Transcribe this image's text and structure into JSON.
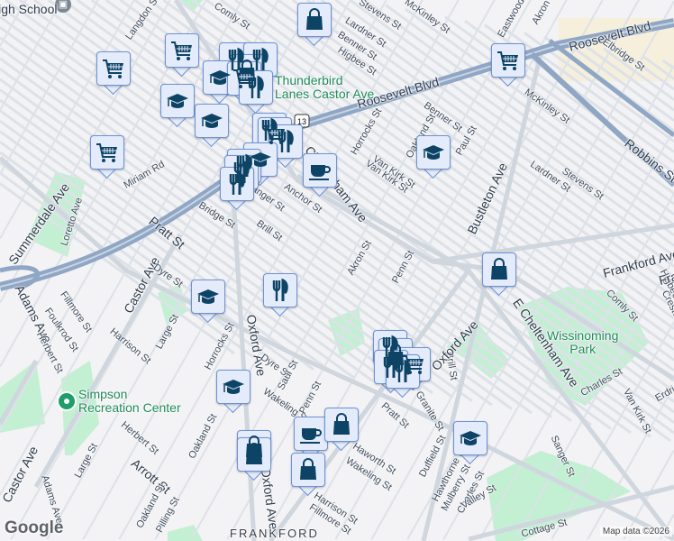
{
  "map": {
    "colors": {
      "background": "#f3f2f4",
      "park": "#c3efd3",
      "highway": "#8fa6c4",
      "road": "#d7dde4",
      "marker_fill": "#e4ebfb",
      "marker_border": "#6d93d6",
      "icon": "#0d4466",
      "poi_text": "#1e8a5a"
    },
    "labels": [
      "High School",
      "Roosevelt Blvd",
      "Roosevelt Blvd",
      "Comly St",
      "Stevens St",
      "Lardner St",
      "Benner St",
      "Higbee St",
      "McKinley St",
      "Eastwood St",
      "Akron St",
      "Elbridge St",
      "McKinley St",
      "Benner St",
      "Horrocks St",
      "Oakland St",
      "Paul St",
      "Van Kirk St",
      "Robbins St",
      "Bustleton Ave",
      "Lardner St",
      "Stevens St",
      "Langdon St",
      "Summerdale Ave",
      "Loretto Ave",
      "Miriam Rd",
      "Pratt St",
      "Bridge St",
      "Brill St",
      "Anchor St",
      "Sanger St",
      "Cheltenham Ave",
      "Akron St",
      "Penn St",
      "Frankford Ave",
      "Castor Ave",
      "Dyre St",
      "Fillmore St",
      "Foulkrod St",
      "Adams Ave",
      "Herbert St",
      "Harrison St",
      "Large St",
      "Horrocks St",
      "Oxford Ave",
      "Dyre St",
      "Saul St",
      "Wakeling St",
      "Penn St",
      "Herbert St",
      "Oakland St",
      "Arrott St",
      "Large St",
      "Castor Ave",
      "Adams Ave",
      "Oakland St",
      "Pilling St",
      "Oxford Ave",
      "Harrison St",
      "Fillmore St",
      "Haworth St",
      "Wakeling St",
      "Pratt St",
      "Granite St",
      "Duffield St",
      "Brill St",
      "Hawthorne St",
      "Mulberry St",
      "Charles St",
      "Valley St",
      "Sanger St",
      "Cottage St",
      "E Cheltenham Ave",
      "Comly St",
      "Creston St",
      "Higbee St",
      "Charles St",
      "Van Kirk St",
      "Erdrick St",
      "Oxford Ave",
      "Van Kirk St",
      "Frankford Ave"
    ],
    "pois": {
      "thunderbird": "Thunderbird\nLanes Castor Ave",
      "simpson": "Simpson\nRecreation Center",
      "wissinoming": "Wissinoming\nPark"
    },
    "district": "FRANKFORD",
    "route_shield": "13",
    "attribution": "Map data ©2026",
    "logo": "Google",
    "marker_types": [
      "shopping-bag",
      "shopping-cart",
      "graduation-cap",
      "restaurant",
      "coffee-cup"
    ]
  }
}
